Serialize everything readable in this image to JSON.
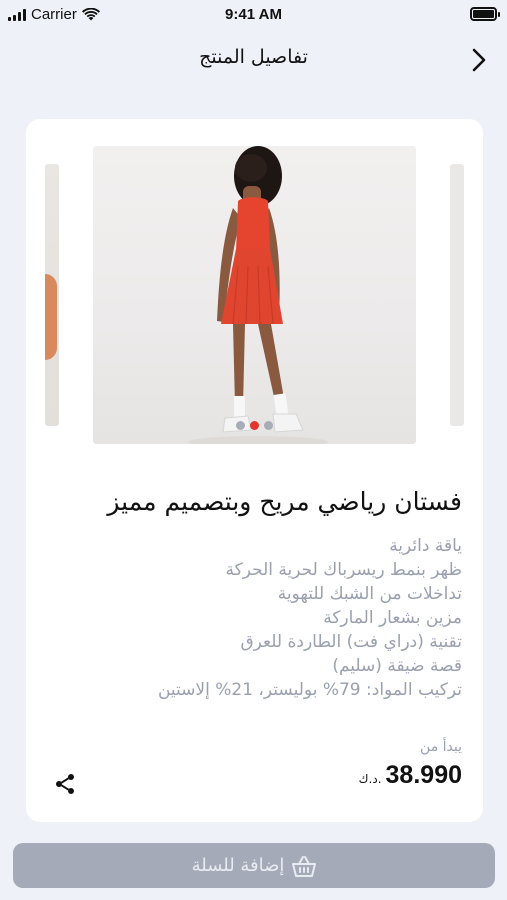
{
  "status_bar": {
    "carrier": "Carrier",
    "time": "9:41 AM"
  },
  "nav": {
    "title": "تفاصيل المنتج",
    "back_icon": "chevron-right-icon"
  },
  "carousel": {
    "slide_count": 3,
    "active_slide": 2,
    "colors": {
      "dot": "#a8acb7",
      "dot_active": "#e0352c",
      "dress": "#e5452f"
    }
  },
  "product": {
    "title": "فستان رياضي مريح وبتصميم مميز",
    "features": [
      "ياقة دائرية",
      "ظهر بنمط ريسرباك لحرية الحركة",
      "تداخلات من الشبك للتهوية",
      "مزين بشعار الماركة",
      "تقنية (دراي فت) الطاردة للعرق",
      "قصة ضيقة (سليم)",
      "تركيب المواد: 79% بوليستر، 21% إلاستين"
    ],
    "price_label": "يبدأ من",
    "price": "38.990",
    "currency": "د.ك."
  },
  "actions": {
    "share_icon": "share-icon",
    "add_to_cart_label": "إضافة للسلة",
    "cart_icon": "basket-icon",
    "button_color": "#a4aab8"
  }
}
